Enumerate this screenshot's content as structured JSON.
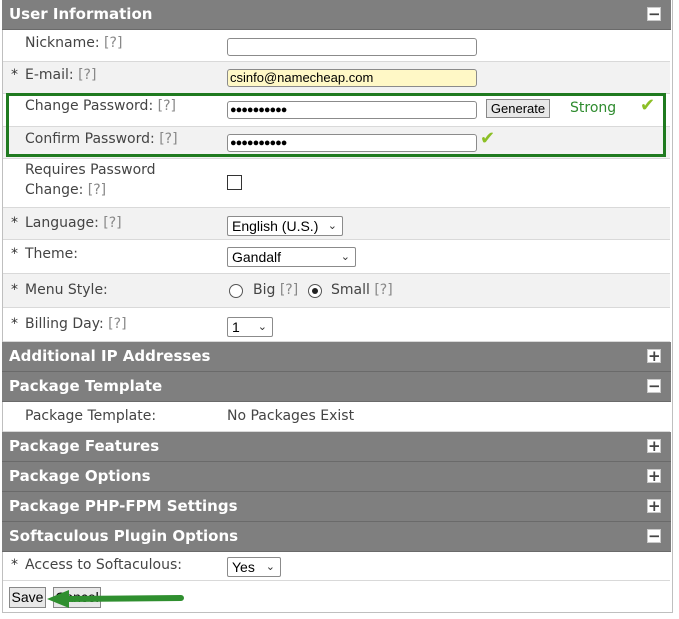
{
  "sections": {
    "user_info": "User Information",
    "additional_ip": "Additional IP Addresses",
    "package_template": "Package Template",
    "package_features": "Package Features",
    "package_options": "Package Options",
    "package_phpfpm": "Package PHP-FPM Settings",
    "softaculous": "Softaculous Plugin Options"
  },
  "toggle": {
    "minus": "−",
    "plus": "+"
  },
  "help": "[?]",
  "required_mark": "*",
  "user": {
    "nickname_label": "Nickname:",
    "nickname_value": "",
    "email_label": "E-mail:",
    "email_value": "csinfo@namecheap.com",
    "change_password_label": "Change Password:",
    "change_password_value": "●●●●●●●●●●",
    "generate_label": "Generate",
    "strength_label": "Strong",
    "confirm_password_label": "Confirm Password:",
    "confirm_password_value": "●●●●●●●●●●",
    "requires_change_label_1": "Requires Password",
    "requires_change_label_2": "Change:",
    "language_label": "Language:",
    "language_value": "English (U.S.)",
    "theme_label": "Theme:",
    "theme_value": "Gandalf",
    "menu_style_label": "Menu Style:",
    "menu_big": "Big",
    "menu_small": "Small",
    "billing_day_label": "Billing Day:",
    "billing_day_value": "1"
  },
  "package": {
    "template_label": "Package Template:",
    "template_value": "No Packages Exist"
  },
  "softaculous": {
    "access_label": "Access to Softaculous:",
    "access_value": "Yes"
  },
  "actions": {
    "save": "Save",
    "cancel": "Cancel"
  },
  "colors": {
    "header": "#7f7f7f",
    "highlight": "#1f7a1f",
    "email_bg": "#fff8c6",
    "check": "#8cbf26",
    "strong": "#2e8b2e"
  }
}
